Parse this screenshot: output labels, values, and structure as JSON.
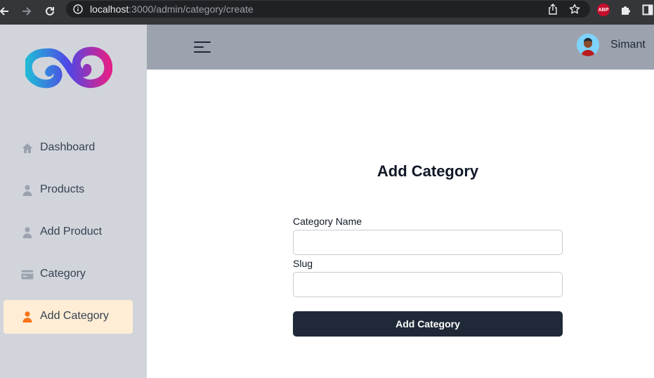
{
  "browser": {
    "url_host": "localhost",
    "url_rest": ":3000/admin/category/create",
    "back_icon": "arrow-left-icon",
    "forward_icon": "arrow-right-icon",
    "reload_icon": "reload-icon",
    "info_icon": "info-icon",
    "share_icon": "share-icon",
    "bookmark_icon": "star-icon",
    "abp_badge": "ABP",
    "extensions_icon": "puzzle-icon",
    "sidepanel_icon": "sidepanel-icon"
  },
  "sidebar": {
    "items": [
      {
        "label": "Dashboard",
        "icon": "home-icon",
        "active": false
      },
      {
        "label": "Products",
        "icon": "user-icon",
        "active": false
      },
      {
        "label": "Add Product",
        "icon": "user-icon",
        "active": false
      },
      {
        "label": "Category",
        "icon": "card-icon",
        "active": false
      },
      {
        "label": "Add Category",
        "icon": "user-icon",
        "active": true
      }
    ]
  },
  "topbar": {
    "menu_icon": "hamburger-icon",
    "username": "Simant"
  },
  "form": {
    "title": "Add Category",
    "name_label": "Category Name",
    "name_value": "",
    "slug_label": "Slug",
    "slug_value": "",
    "submit_label": "Add Category"
  },
  "colors": {
    "sidebar_bg": "#d1d5db",
    "topbar_bg": "#9ca3af",
    "active_item_bg": "#ffedd5",
    "active_icon": "#f97316",
    "button_bg": "#1f2937"
  }
}
